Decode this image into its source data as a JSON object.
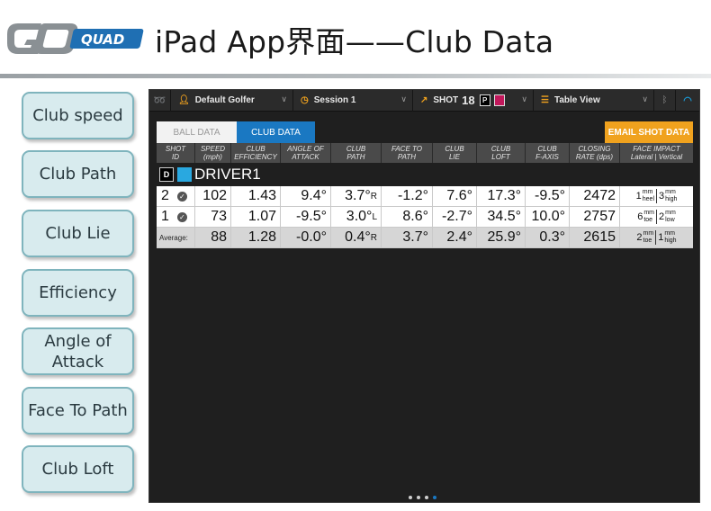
{
  "slide": {
    "logo_text": "GCQUAD",
    "title": "iPad App界面——Club Data"
  },
  "side_buttons": [
    {
      "label": "Club speed"
    },
    {
      "label": "Club Path"
    },
    {
      "label": "Club Lie"
    },
    {
      "label": "Efficiency"
    },
    {
      "label": "Angle of Attack"
    },
    {
      "label": "Face To Path"
    },
    {
      "label": "Club Loft"
    }
  ],
  "app": {
    "topbar": {
      "golfer": "Default Golfer",
      "session": "Session 1",
      "shot_label": "SHOT",
      "shot_number": "18",
      "p_badge": "P",
      "view": "Table View"
    },
    "tabs": {
      "ball_data": "BALL DATA",
      "club_data": "CLUB DATA",
      "active": "CLUB DATA"
    },
    "email_button": "EMAIL SHOT DATA",
    "columns": [
      {
        "l1": "SHOT",
        "l2": "ID"
      },
      {
        "l1": "SPEED",
        "l2": "(mph)"
      },
      {
        "l1": "CLUB",
        "l2": "EFFICIENCY"
      },
      {
        "l1": "ANGLE OF",
        "l2": "ATTACK"
      },
      {
        "l1": "CLUB",
        "l2": "PATH"
      },
      {
        "l1": "FACE TO",
        "l2": "PATH"
      },
      {
        "l1": "CLUB",
        "l2": "LIE"
      },
      {
        "l1": "CLUB",
        "l2": "LOFT"
      },
      {
        "l1": "CLUB",
        "l2": "F-AXIS"
      },
      {
        "l1": "CLOSING",
        "l2": "RATE (dps)"
      },
      {
        "l1": "FACE IMPACT",
        "l2": "Lateral | Vertical"
      }
    ],
    "group": {
      "badge": "D",
      "name": "DRIVER1",
      "color": "#29a8e0"
    },
    "rows": [
      {
        "id": "2",
        "speed": "102",
        "efficiency": "1.43",
        "aoa": "9.4°",
        "path": "3.7°",
        "path_dir": "R",
        "face_to_path": "-1.2°",
        "lie": "7.6°",
        "loft": "17.3°",
        "f_axis": "-9.5°",
        "closing": "2472",
        "impact": {
          "lat_num": "1",
          "lat_unit": "mm",
          "lat_dir": "heel",
          "vert_num": "3",
          "vert_unit": "mm",
          "vert_dir": "high"
        }
      },
      {
        "id": "1",
        "speed": "73",
        "efficiency": "1.07",
        "aoa": "-9.5°",
        "path": "3.0°",
        "path_dir": "L",
        "face_to_path": "8.6°",
        "lie": "-2.7°",
        "loft": "34.5°",
        "f_axis": "10.0°",
        "closing": "2757",
        "impact": {
          "lat_num": "6",
          "lat_unit": "mm",
          "lat_dir": "toe",
          "vert_num": "2",
          "vert_unit": "mm",
          "vert_dir": "low"
        }
      }
    ],
    "average": {
      "label": "Average:",
      "speed": "88",
      "efficiency": "1.28",
      "aoa": "-0.0°",
      "path": "0.4°",
      "path_dir": "R",
      "face_to_path": "3.7°",
      "lie": "2.4°",
      "loft": "25.9°",
      "f_axis": "0.3°",
      "closing": "2615",
      "impact": {
        "lat_num": "2",
        "lat_unit": "mm",
        "lat_dir": "toe",
        "vert_num": "1",
        "vert_unit": "mm",
        "vert_dir": "high"
      }
    },
    "page_dots": {
      "count": 4,
      "active": 4
    },
    "colors": {
      "accent_blue": "#1a78c2",
      "email_orange": "#f0a21e",
      "shot_color": "#c2185b"
    }
  }
}
